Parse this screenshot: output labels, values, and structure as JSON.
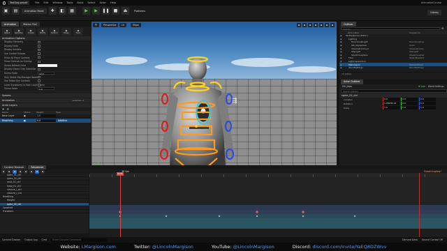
{
  "menu": {
    "file_title": "TestSeq.uasset",
    "items": [
      "File",
      "Edit",
      "Window",
      "Tools",
      "Build",
      "Select",
      "Actor",
      "Help"
    ],
    "project": "AnimationCourse"
  },
  "toolbar": {
    "mode_label": "Animation Mode",
    "tab_viewport": "Viewport 1",
    "platforms": "Platforms",
    "udemy_button": "Udemy",
    "buttons": [
      "Select",
      "Selection",
      "Create",
      "Modify",
      "Deform",
      "Poses",
      "Tools"
    ]
  },
  "left_panel": {
    "tab_animation": "Animation",
    "tab_motion_trails": "Motion Trail",
    "section_options": "Animation Options",
    "props": [
      "Display Hierarchy",
      "Display Nulls",
      "Display Sockets",
      "Use Control Shapes",
      "Show All Proxy Controls",
      "Show Controls as Overlay",
      "Gizmo Default Color",
      "Display Gizmo Only Selection",
      "Gizmo Scale",
      "Only Select Rig Manager Nodes",
      "Use Select Key Controls",
      "Local Transforms in Each Local Space",
      "Gizmo Scale"
    ],
    "gizmo_value": "10.0",
    "gizmo2_value": "1.0",
    "section_spaces": "Spaces",
    "section_animation": "Animation",
    "section_layers": "Anim Layers",
    "layers_header": [
      "Name",
      "Status",
      "Weight",
      "Type"
    ],
    "base_layer": {
      "name": "Base Layer",
      "weight": "1.0"
    },
    "breathing_layer": {
      "name": "Breathing",
      "weight": "0.0",
      "type": "Additive"
    },
    "selected_label": "selected: 0"
  },
  "viewport": {
    "perspective": "Perspective",
    "lit": "Lit",
    "show": "Show"
  },
  "outliner": {
    "title": "Outliner",
    "tab_dock": "Sequencer",
    "col_label": "Item Label",
    "col_type": "Sequencer",
    "search_placeholder": "Search...",
    "rows": [
      {
        "label": "TestSeqLevel (Editor)",
        "type": "",
        "indent": 0
      },
      {
        "label": "Lighting",
        "type": "",
        "indent": 1
      },
      {
        "label": "DirectionalLight",
        "type": "DirectionalLig",
        "indent": 2
      },
      {
        "label": "SM_SkySphere",
        "type": "Actor",
        "indent": 2
      },
      {
        "label": "VolumetricCloud",
        "type": "VolumetricClo",
        "indent": 2
      },
      {
        "label": "SkyLight",
        "type": "SkyLight",
        "indent": 2
      },
      {
        "label": "SkyAtmosphere",
        "type": "SkyAtmospher",
        "indent": 2
      },
      {
        "label": "Floor",
        "type": "StaticMeshAct",
        "indent": 1
      },
      {
        "label": "LightmassActors",
        "type": "",
        "indent": 1
      },
      {
        "label": "Mannequin",
        "type": "SkeletalMesh",
        "indent": 1
      },
      {
        "label": "WorldSettings",
        "type": "WorldSettings",
        "indent": 1
      }
    ],
    "actor_count": "13 actors",
    "details_title": "Actor Outliner",
    "details_item": "Ctrl_hips",
    "details_add": "Add",
    "details_settings": "World Settings",
    "details_search": "Search Details",
    "details_section": "spine_02_ctrl",
    "transform_rows": [
      {
        "label": "Location",
        "x": "0.0",
        "y": "0.0",
        "z": "0.0"
      },
      {
        "label": "Rotation",
        "x": "1.0823E-16",
        "y": "0.0",
        "z": "0.0"
      },
      {
        "label": "Scale",
        "x": "1.0",
        "y": "1.0",
        "z": "1.0"
      }
    ]
  },
  "sequencer": {
    "tab_content_browser": "Content Browser",
    "tab_sequencer": "Sequencer",
    "fps": "30 fps",
    "seq_name": "BreathingSeq*",
    "tracks": [
      "spine_01_ctrl",
      "spine_02_ctrl",
      "neck_01_ctrl",
      "head_01_ctrl",
      "clavicle_l_ctrl",
      "clavicle_r_ctrl",
      "Breathing",
      "Weight",
      "spine_02_ctrl",
      "Spawned",
      "Transform"
    ],
    "start_frame": "0000",
    "end_frame": "0150",
    "current_frame": "0045"
  },
  "status": {
    "content_drawer": "Content Drawer",
    "output_log": "Output Log",
    "cmd": "Cmd",
    "console_placeholder": "Enter Console Command",
    "derived_data": "Derived Data",
    "source_control": "Source Control Off"
  },
  "banner": {
    "website_label": "Website:",
    "website_url": "LMargison.com",
    "twitter_label": "Twitter:",
    "twitter_handle": "@LincolnMargison",
    "youtube_label": "YouTube:",
    "youtube_handle": "@LincolnMargison",
    "discord_label": "Discord:",
    "discord_url": "discord.com/invite/YaEQ8DZWvv"
  },
  "colors": {
    "accent": "#4d9bff",
    "play": "#5fcf3e",
    "layer_selected": "#1d4f7a",
    "key_diamond": "#d06a6a"
  }
}
